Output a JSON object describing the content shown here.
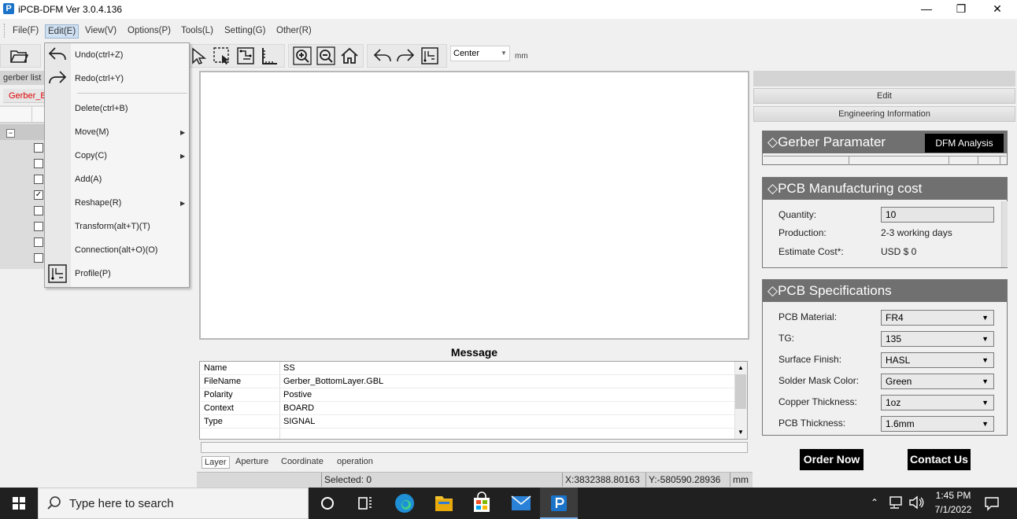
{
  "window": {
    "title": "iPCB-DFM Ver 3.0.4.136",
    "app_icon": "P",
    "minimize": "—",
    "maximize": "❐",
    "close": "✕"
  },
  "menubar": {
    "items": [
      "File(F)",
      "Edit(E)",
      "View(V)",
      "Options(P)",
      "Tools(L)",
      "Setting(G)",
      "Other(R)"
    ]
  },
  "toolbar": {
    "center_value": "Center",
    "unit": "mm"
  },
  "edit_menu": {
    "items": [
      {
        "label": "Undo(ctrl+Z)",
        "icon": "undo-icon"
      },
      {
        "label": "Redo(ctrl+Y)",
        "icon": "redo-icon"
      },
      {
        "label": "Delete(ctrl+B)"
      },
      {
        "label": "Move(M)",
        "submenu": true
      },
      {
        "label": "Copy(C)",
        "submenu": true
      },
      {
        "label": "Add(A)"
      },
      {
        "label": "Reshape(R)",
        "submenu": true
      },
      {
        "label": "Transform(alt+T)(T)"
      },
      {
        "label": "Connection(alt+O)(O)"
      },
      {
        "label": "Profile(P)",
        "icon": "profile-icon"
      }
    ]
  },
  "left_panel": {
    "tab_label": "gerber list",
    "file_tab": "Gerber_B",
    "collapse": "−",
    "checkboxes": [
      false,
      false,
      false,
      true,
      false,
      false,
      false,
      false
    ]
  },
  "message": {
    "title": "Message",
    "rows": [
      {
        "key": "Name",
        "value": "SS"
      },
      {
        "key": "FileName",
        "value": "Gerber_BottomLayer.GBL"
      },
      {
        "key": "Polarity",
        "value": "Postive"
      },
      {
        "key": "Context",
        "value": "BOARD"
      },
      {
        "key": "Type",
        "value": "SIGNAL"
      }
    ],
    "tabs": [
      "Layer",
      "Aperture",
      "Coordinate",
      "operation"
    ]
  },
  "statusbar": {
    "selected": "Selected: 0",
    "x": "X:3832388.80163",
    "y": "Y:-580590.28936",
    "unit": "mm"
  },
  "right_panel": {
    "edit_label": "Edit",
    "engineering_label": "Engineering Information",
    "gerber_section": {
      "title": "Gerber Paramater",
      "dfm_button": "DFM Analysis"
    },
    "cost_section": {
      "title": "PCB Manufacturing cost",
      "quantity_label": "Quantity:",
      "quantity_value": "10",
      "production_label": "Production:",
      "production_value": "2-3 working days",
      "estimate_label": "Estimate Cost*:",
      "estimate_value": "USD $ 0"
    },
    "spec_section": {
      "title": "PCB Specifications",
      "fields": [
        {
          "label": "PCB Material:",
          "value": "FR4"
        },
        {
          "label": "TG:",
          "value": "135"
        },
        {
          "label": "Surface Finish:",
          "value": "HASL"
        },
        {
          "label": "Solder Mask Color:",
          "value": "Green"
        },
        {
          "label": "Copper Thickness:",
          "value": "1oz"
        },
        {
          "label": "PCB Thickness:",
          "value": "1.6mm"
        }
      ]
    },
    "order_button": "Order Now",
    "contact_button": "Contact Us"
  },
  "taskbar": {
    "search_placeholder": "Type here to search",
    "time": "1:45 PM",
    "date": "7/1/2022"
  },
  "colors": {
    "section_header": "#707070",
    "button_black": "#000000",
    "file_tab_red": "#dd0000",
    "taskbar": "#202020"
  }
}
